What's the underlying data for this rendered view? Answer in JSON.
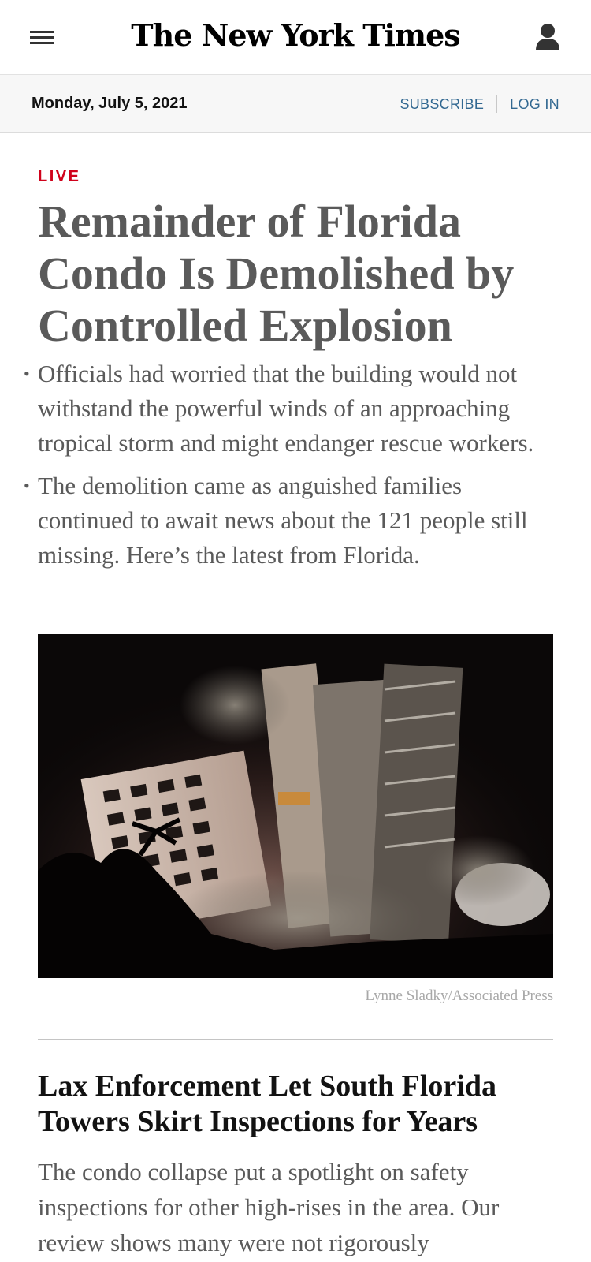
{
  "header": {
    "logo_text": "The New York Times",
    "date": "Monday, July 5, 2021",
    "subscribe_label": "SUBSCRIBE",
    "login_label": "LOG IN"
  },
  "icons": {
    "menu": "menu-icon",
    "account": "user-icon"
  },
  "lead_story": {
    "label": "LIVE",
    "headline": "Remainder of Florida Condo Is Demolished by Controlled Explosion",
    "bullets": [
      "Officials had worried that the building would not withstand the powerful winds of an approaching tropical storm and might endanger rescue workers.",
      "The demolition came as anguished families continued to await news about the 121 people still missing. Here’s the latest from Florida."
    ],
    "photo_credit": "Lynne Sladky/Associated Press"
  },
  "second_story": {
    "headline": "Lax Enforcement Let South Florida Towers Skirt Inspections for Years",
    "summary": "The condo collapse put a spotlight on safety inspections for other high-rises in the area. Our review shows many were not rigorously"
  },
  "colors": {
    "live_red": "#d0021b",
    "link_blue": "#326891",
    "headline_gray": "#5a5a5a"
  }
}
